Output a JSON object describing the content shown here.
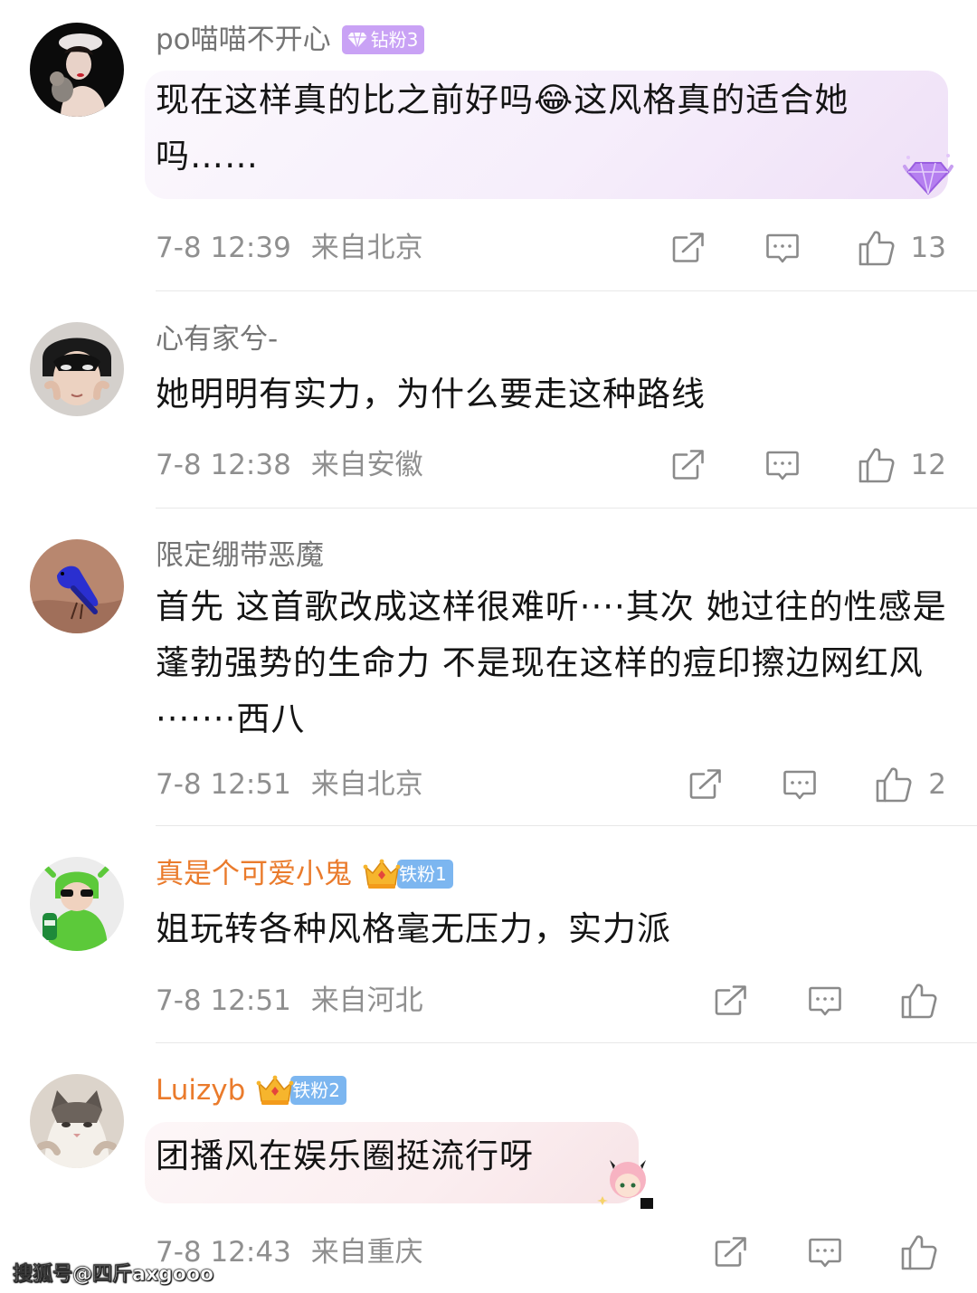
{
  "comments": [
    {
      "username": "po喵喵不开心",
      "badge": "钻粉3",
      "text": "现在这样真的比之前好吗😂这风格真的适合她吗……",
      "time": "7-8 12:39",
      "location": "来自北京",
      "likes": "13"
    },
    {
      "username": "心有家兮-",
      "text": "她明明有实力，为什么要走这种路线",
      "time": "7-8 12:38",
      "location": "来自安徽",
      "likes": "12"
    },
    {
      "username": "限定绷带恶魔",
      "text": "首先 这首歌改成这样很难听····其次 她过往的性感是蓬勃强势的生命力 不是现在这样的痘印擦边网红风·······西八",
      "time": "7-8 12:51",
      "location": "来自北京",
      "likes": "2"
    },
    {
      "username": "真是个可爱小鬼",
      "badge": "铁粉1",
      "text": "姐玩转各种风格毫无压力，实力派",
      "time": "7-8 12:51",
      "location": "来自河北",
      "likes": ""
    },
    {
      "username": "Luizyb",
      "badge": "铁粉2",
      "text": "团播风在娱乐圈挺流行呀",
      "time": "7-8 12:43",
      "location": "来自重庆",
      "likes": ""
    }
  ],
  "watermark": "搜狐号@四斤axgooo",
  "colors": {
    "username": "#757575",
    "vip_username": "#ea7b2c",
    "meta": "#8f8f8f",
    "diamond_badge": "#c9a2f5",
    "iron_badge": "#7cb6f0"
  },
  "icons": [
    "share-icon",
    "comment-icon",
    "thumbs-up-icon",
    "diamond-icon",
    "crown-icon"
  ]
}
